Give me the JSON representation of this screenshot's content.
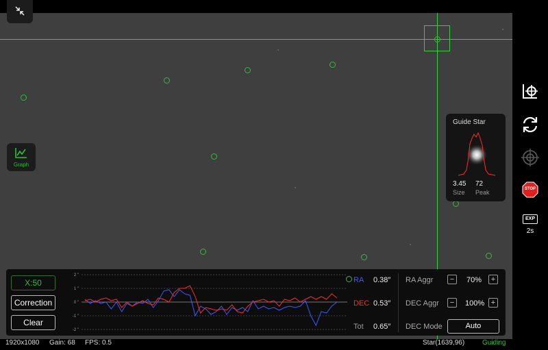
{
  "toolbar_left": {
    "collapse_icon": "collapse-arrows-icon",
    "graph_label": "Graph"
  },
  "right_toolbar": {
    "target_icon": "crosshair-target-icon",
    "refresh_icon": "refresh-loop-icon",
    "guide_icon": "guide-crosshair-icon",
    "stop_label": "STOP",
    "exp_label": "EXP",
    "exp_value": "2s"
  },
  "guide_star": {
    "title": "Guide Star",
    "size_value": "3.45",
    "size_label": "Size",
    "peak_value": "72",
    "peak_label": "Peak"
  },
  "graph": {
    "scale_label": "X:50",
    "correction_label": "Correction",
    "clear_label": "Clear",
    "y_ticks": [
      "2 \"",
      "1 \"",
      "0 \"",
      "-1 \"",
      "-2 \""
    ],
    "ra_label": "RA",
    "ra_value": "0.38″",
    "dec_label": "DEC",
    "dec_value": "0.53″",
    "tot_label": "Tot",
    "tot_value": "0.65″"
  },
  "chart_data": {
    "type": "line",
    "ylim": [
      -2,
      2
    ],
    "series": [
      {
        "name": "RA",
        "color": "#3b5bff",
        "values": [
          0.2,
          -0.1,
          0.1,
          -0.1,
          0.0,
          -0.5,
          0.0,
          -0.7,
          -0.1,
          -0.3,
          0.0,
          -0.1,
          0.2,
          -0.4,
          0.1,
          0.8,
          0.9,
          0.4,
          0.9,
          0.6,
          0.5,
          -1.0,
          -0.3,
          -0.5,
          -0.9,
          -0.7,
          -0.3,
          -0.9,
          -0.4,
          -0.6,
          -0.4,
          -0.7,
          0.1,
          -0.5,
          -0.3,
          -0.5,
          -0.4,
          -0.6,
          -0.4,
          -0.3,
          -0.4,
          -0.3,
          0.1,
          -1.0,
          -1.7,
          -0.7,
          -0.8,
          -0.3,
          0.0
        ]
      },
      {
        "name": "DEC",
        "color": "#ff2a2a",
        "values": [
          0.1,
          0.2,
          0.0,
          0.2,
          0.3,
          0.1,
          0.2,
          -0.4,
          0.0,
          -0.3,
          -0.1,
          0.1,
          -0.1,
          -0.2,
          0.3,
          0.2,
          0.0,
          0.7,
          1.0,
          1.0,
          1.2,
          0.4,
          -0.8,
          -0.4,
          -0.5,
          -0.6,
          -0.5,
          -0.6,
          -0.2,
          -0.7,
          -0.8,
          -0.3,
          0.0,
          0.1,
          0.2,
          0.0,
          0.1,
          -0.3,
          0.2,
          0.1,
          0.3,
          0.0,
          0.2,
          0.4,
          0.2,
          0.4,
          0.2,
          0.6,
          0.3
        ]
      }
    ]
  },
  "aggression": {
    "ra_label": "RA Aggr",
    "ra_value": "70%",
    "dec_label": "DEC Aggr",
    "dec_value": "100%",
    "mode_label": "DEC Mode",
    "mode_value": "Auto",
    "minus": "−",
    "plus": "+"
  },
  "status": {
    "resolution": "1920x1080",
    "gain": "Gain: 68",
    "fps": "FPS: 0.5",
    "star": "Star(1639,96)",
    "state": "Guiding",
    "state_color": "#2fbf3a"
  }
}
